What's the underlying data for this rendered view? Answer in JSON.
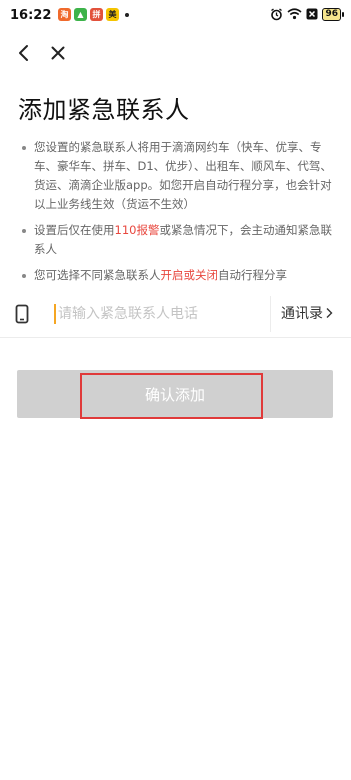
{
  "status_bar": {
    "time": "16:22",
    "battery": "96",
    "app_icons": [
      {
        "name": "app-icon-orange",
        "color": "#f06a2c",
        "glyph": "淘"
      },
      {
        "name": "app-icon-green",
        "color": "#3db34a",
        "glyph": "▲"
      },
      {
        "name": "app-icon-red",
        "color": "#e2513b",
        "glyph": "拼"
      },
      {
        "name": "app-icon-yellow",
        "color": "#f5c400",
        "glyph": "美"
      }
    ]
  },
  "nav": {
    "back_icon": "chevron-left-icon",
    "close_icon": "close-icon"
  },
  "page": {
    "title": "添加紧急联系人"
  },
  "notes": {
    "note1": "您设置的紧急联系人将用于滴滴网约车（快车、优享、专车、豪华车、拼车、D1、优步）、出租车、顺风车、代驾、货运、滴滴企业版app。如您开启自动行程分享，也会针对以上业务线生效（货运不生效）",
    "note2_before": "设置后仅在使用",
    "note2_highlight": "110报警",
    "note2_after": "或紧急情况下，会主动通知紧急联系人",
    "note3_before": "您可选择不同紧急联系人",
    "note3_highlight": "开启或关闭",
    "note3_after": "自动行程分享"
  },
  "phone_input": {
    "value": "",
    "placeholder": "请输入紧急联系人电话",
    "contacts_label": "通讯录"
  },
  "confirm": {
    "label": "确认添加"
  },
  "colors": {
    "highlight": "#e8473e",
    "cursor": "#f5a623",
    "button_disabled": "#d0d0d0",
    "annotation_box": "#e03a3a"
  }
}
